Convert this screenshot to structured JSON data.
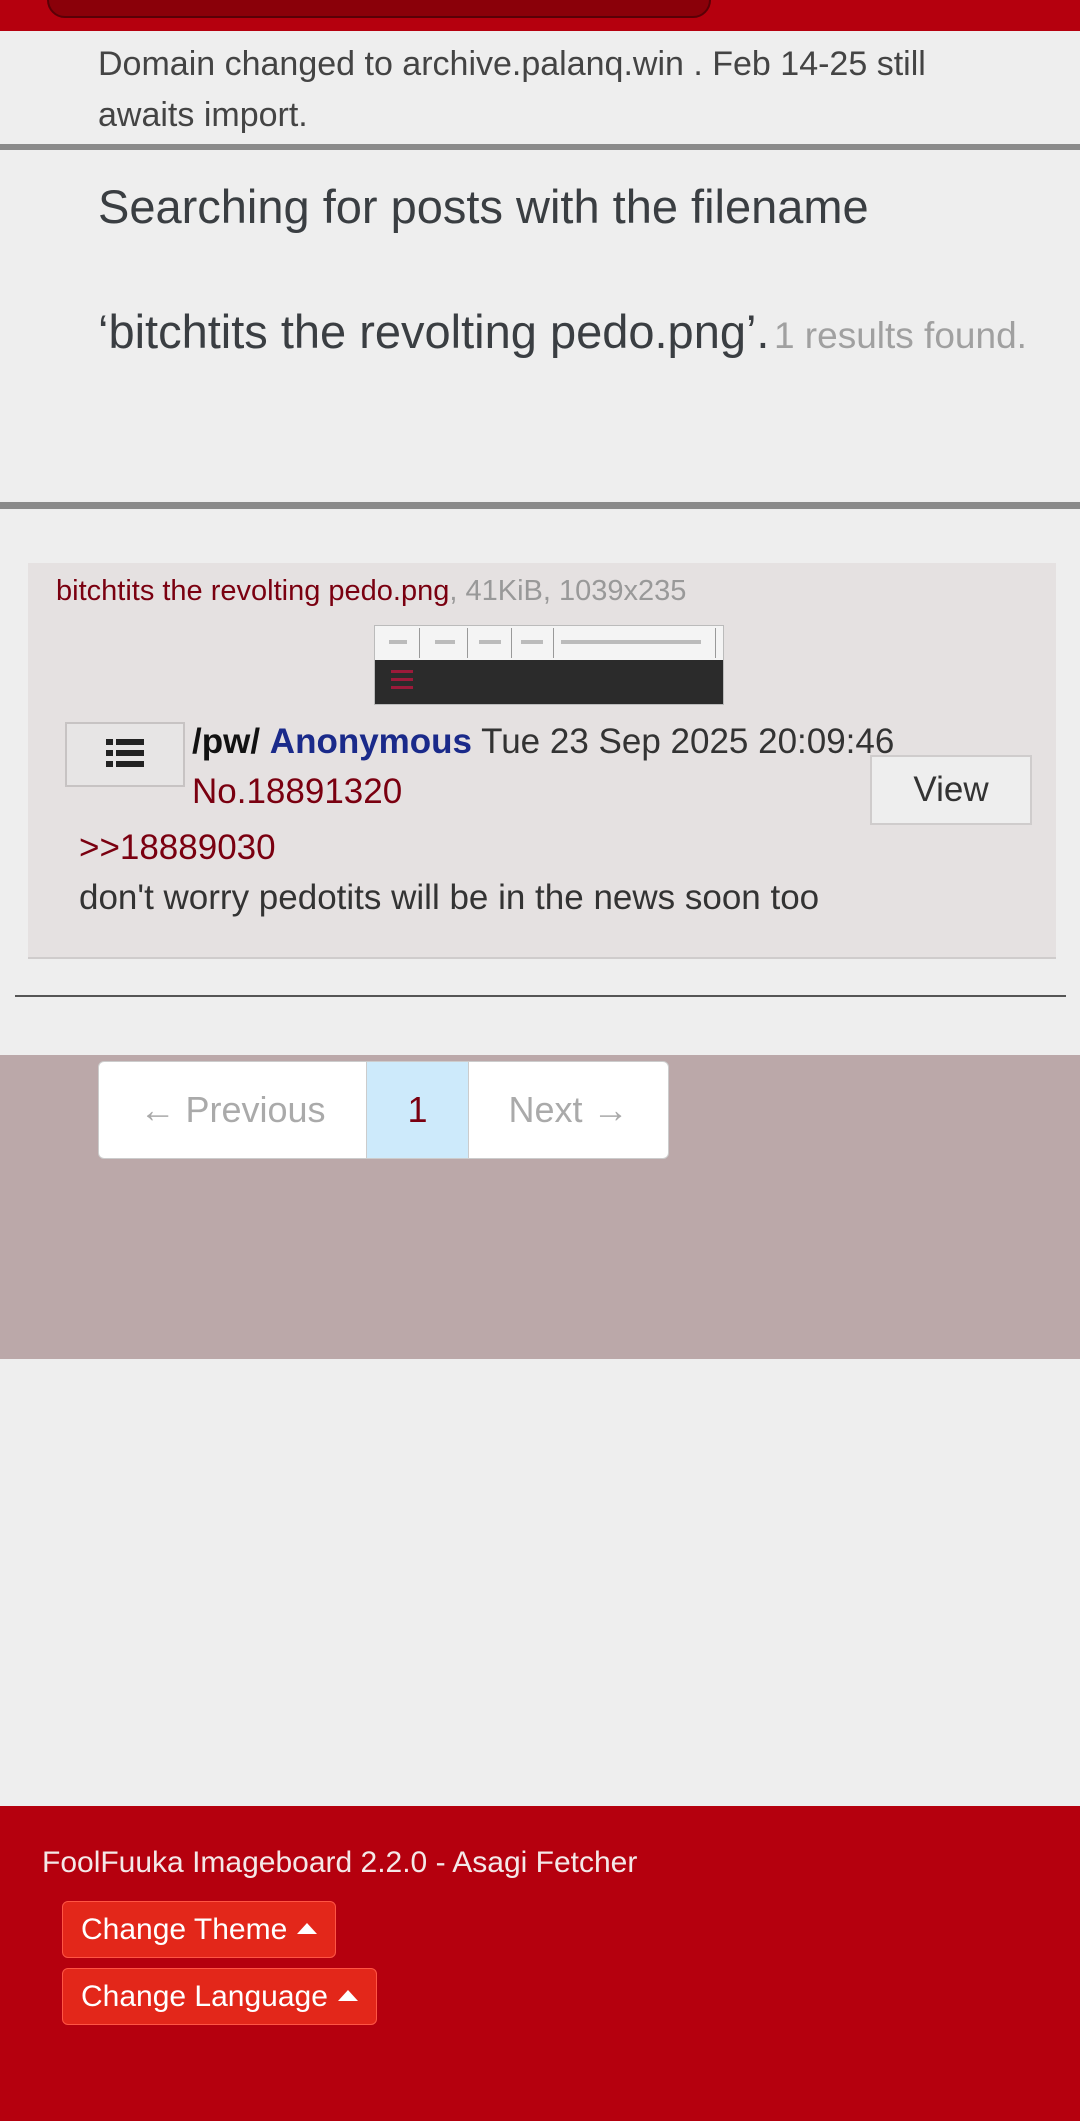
{
  "notice": {
    "text": "Domain changed to archive.palanq.win . Feb 14-25 still awaits import."
  },
  "search": {
    "title": "Searching for posts with the filename ‘bitchtits the revolting pedo.png’.",
    "count": "1 results found."
  },
  "post": {
    "filename": "bitchtits the revolting pedo.png",
    "file_meta": ", 41KiB, 1039x235",
    "board": "/pw/",
    "author": "Anonymous",
    "date": "Tue 23 Sep 2025 20:09:46",
    "number": "No.18891320",
    "view_label": "View",
    "quote": ">>18889030",
    "comment": "don't worry pedotits will be in the news soon too",
    "menu_icon": "list-icon"
  },
  "pagination": {
    "prev": "← Previous",
    "current": "1",
    "next": "Next →"
  },
  "footer": {
    "credits": "FoolFuuka Imageboard 2.2.0 - Asagi Fetcher",
    "theme_label": "Change Theme",
    "language_label": "Change Language"
  },
  "colors": {
    "brand_red": "#b5000e",
    "link_red": "#7a0010",
    "author_blue": "#1a2a8a",
    "pager_bg": "#bba8a9"
  }
}
